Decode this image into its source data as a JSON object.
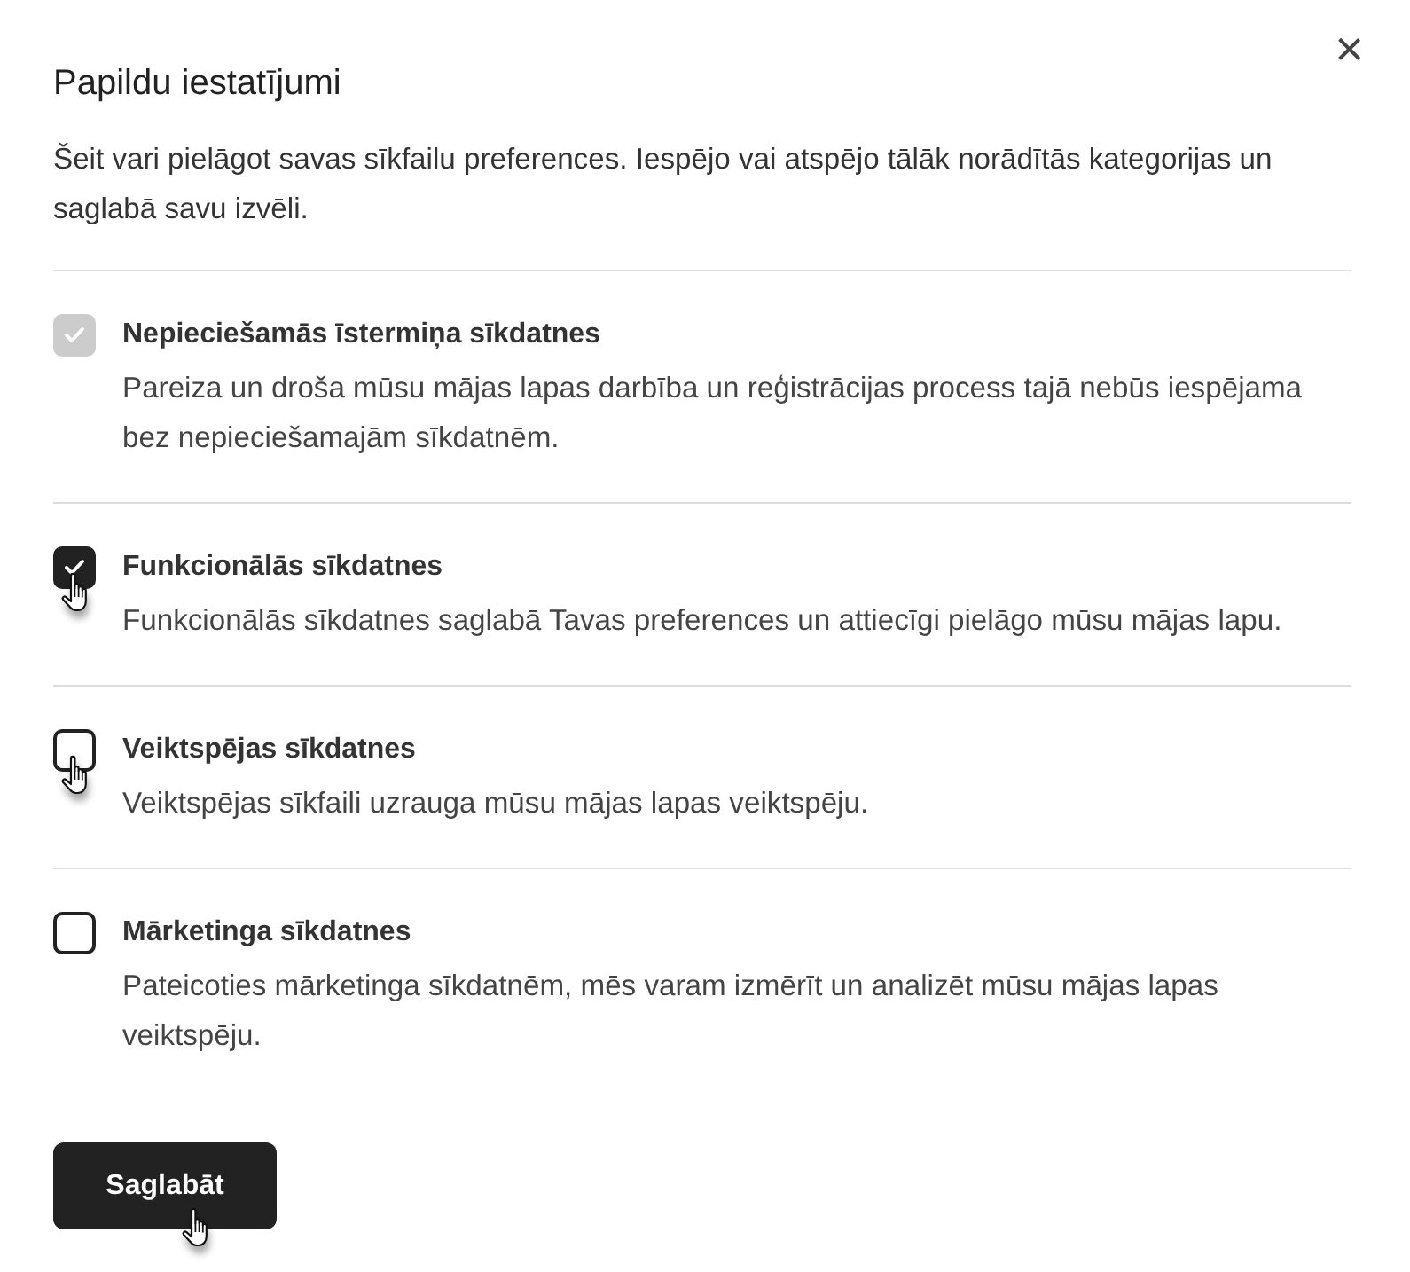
{
  "dialog": {
    "title": "Papildu iestatījumi",
    "close": "×",
    "intro": "Šeit vari pielāgot savas sīkfailu preferences. Iespējo vai atspējo tālāk norādītās kategorijas un saglabā savu izvēli.",
    "categories": [
      {
        "title": "Nepieciešamās īstermiņa sīkdatnes",
        "description": "Pareiza un droša mūsu mājas lapas darbība un reģistrācijas process tajā nebūs iespējama bez nepieciešamajām sīkdatnēm.",
        "checked": true,
        "disabled": true,
        "hovered": false
      },
      {
        "title": "Funkcionālās sīkdatnes",
        "description": "Funkcionālās sīkdatnes saglabā Tavas preferences un attiecīgi pielāgo mūsu mājas lapu.",
        "checked": true,
        "disabled": false,
        "hovered": true
      },
      {
        "title": "Veiktspējas sīkdatnes",
        "description": "Veiktspējas sīkfaili uzrauga mūsu mājas lapas veiktspēju.",
        "checked": false,
        "disabled": false,
        "hovered": true
      },
      {
        "title": "Mārketinga sīkdatnes",
        "description": "Pateicoties mārketinga sīkdatnēm, mēs varam izmērīt un analizēt mūsu mājas lapas veiktspēju.",
        "checked": false,
        "disabled": false,
        "hovered": false
      }
    ],
    "save_button": {
      "label": "Saglabāt",
      "hovered": true
    }
  }
}
